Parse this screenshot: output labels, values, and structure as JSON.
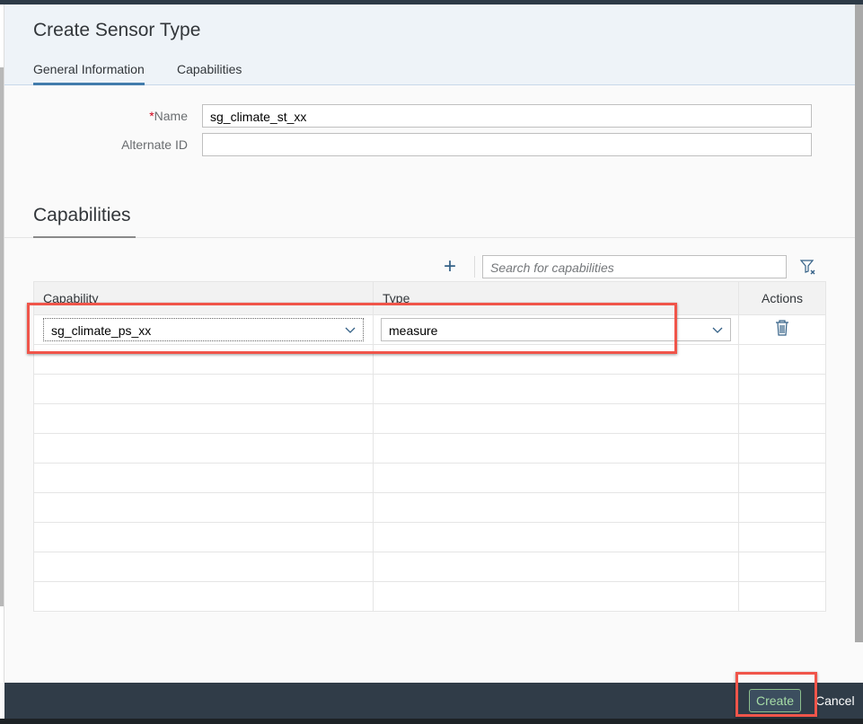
{
  "dialog": {
    "title": "Create Sensor Type"
  },
  "tabs": [
    {
      "label": "General Information",
      "active": true
    },
    {
      "label": "Capabilities",
      "active": false
    }
  ],
  "form": {
    "name_label": "Name",
    "required_marker": "*",
    "name_value": "sg_climate_st_xx",
    "alternate_id_label": "Alternate ID",
    "alternate_id_value": ""
  },
  "capabilities": {
    "title": "Capabilities",
    "search_placeholder": "Search for capabilities",
    "columns": [
      "Capability",
      "Type",
      "Actions"
    ],
    "rows": [
      {
        "capability": "sg_climate_ps_xx",
        "type": "measure"
      }
    ],
    "empty_rows": 9
  },
  "footer": {
    "create_label": "Create",
    "cancel_label": "Cancel"
  },
  "colors": {
    "accent": "#427cac",
    "highlight": "#f0554a",
    "footer": "#303c48"
  }
}
